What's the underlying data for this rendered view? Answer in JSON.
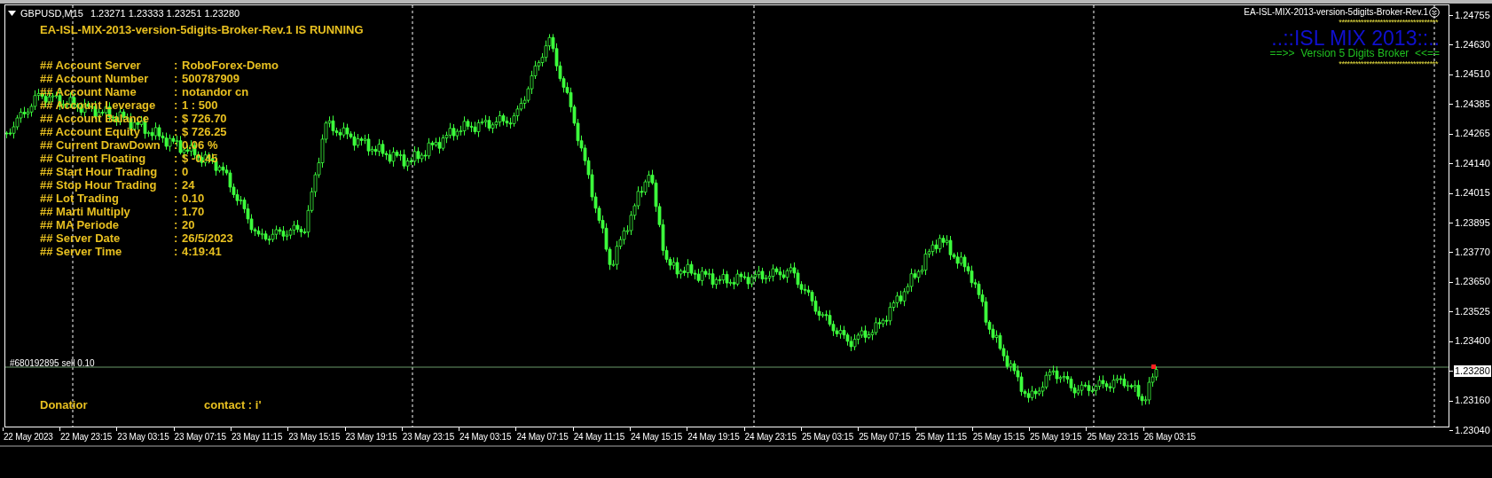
{
  "chart_header": {
    "symbol": "GBPUSD,M15",
    "quotes": "1.23271 1.23333 1.23251 1.23280"
  },
  "expert": {
    "status_title": "EA-ISL-MIX-2013-version-5digits-Broker-Rev.1 IS RUNNING",
    "rows": [
      {
        "label": "## Account Server",
        "sep": ":",
        "value": "RoboForex-Demo"
      },
      {
        "label": "## Account Number",
        "sep": ":",
        "value": "500787909"
      },
      {
        "label": "## Account Name",
        "sep": ":",
        "value": "notandor cn"
      },
      {
        "label": "## Account Leverage",
        "sep": ":",
        "value": "1 : 500"
      },
      {
        "label": "## Account Balance",
        "sep": ":",
        "value": "$ 726.70"
      },
      {
        "label": "## Account Equity",
        "sep": ":",
        "value": "$ 726.25"
      },
      {
        "label": "## Current DrawDown",
        "sep": ":",
        "value": "0.06 %"
      },
      {
        "label": "## Current Floating",
        "sep": ":",
        "value": "$ -0.45"
      },
      {
        "label": "## Start Hour Trading",
        "sep": ":",
        "value": "0"
      },
      {
        "label": "## Stop Hour Trading",
        "sep": ":",
        "value": "24"
      },
      {
        "label": "## Lot Trading",
        "sep": ":",
        "value": "0.10"
      },
      {
        "label": "## Marti Multiply",
        "sep": ":",
        "value": "1.70"
      },
      {
        "label": "## MA Periode",
        "sep": ":",
        "value": "20"
      },
      {
        "label": "## Server Date",
        "sep": ":",
        "value": "26/5/2023"
      },
      {
        "label": "## Server Time",
        "sep": ":",
        "value": "4:19:41"
      }
    ],
    "footer_left": "Donatior",
    "footer_right": "contact : i'"
  },
  "expert_badge": {
    "name": "EA-ISL-MIX-2013-version-5digits-Broker-Rev.1",
    "stars_top": "************************************",
    "logo": "..::ISL MIX 2013::..",
    "version": "==>>  Version 5 Digits Broker  <<==",
    "stars_bottom": "************************************"
  },
  "order_line": {
    "label": "#680192895 sell 0.10"
  },
  "price_axis": [
    {
      "label": "1.24755",
      "current": false
    },
    {
      "label": "1.24630",
      "current": false
    },
    {
      "label": "1.24510",
      "current": false
    },
    {
      "label": "1.24385",
      "current": false
    },
    {
      "label": "1.24265",
      "current": false
    },
    {
      "label": "1.24140",
      "current": false
    },
    {
      "label": "1.24015",
      "current": false
    },
    {
      "label": "1.23895",
      "current": false
    },
    {
      "label": "1.23770",
      "current": false
    },
    {
      "label": "1.23650",
      "current": false
    },
    {
      "label": "1.23525",
      "current": false
    },
    {
      "label": "1.23400",
      "current": false
    },
    {
      "label": "1.23280",
      "current": true
    },
    {
      "label": "1.23160",
      "current": false
    },
    {
      "label": "1.23040",
      "current": false
    }
  ],
  "time_axis": [
    "22 May 2023",
    "22 May 23:15",
    "23 May 03:15",
    "23 May 07:15",
    "23 May 11:15",
    "23 May 15:15",
    "23 May 19:15",
    "23 May 23:15",
    "24 May 03:15",
    "24 May 07:15",
    "24 May 11:15",
    "24 May 15:15",
    "24 May 19:15",
    "24 May 23:15",
    "25 May 03:15",
    "25 May 07:15",
    "25 May 11:15",
    "25 May 15:15",
    "25 May 19:15",
    "25 May 23:15",
    "26 May 03:15"
  ]
}
